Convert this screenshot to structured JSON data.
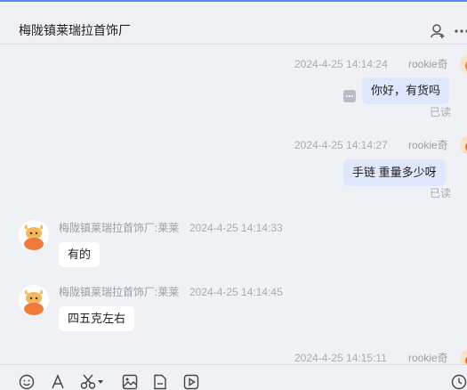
{
  "header": {
    "title": "梅陇镇莱瑞拉首饰厂",
    "icons": [
      "add-user-icon",
      "more-horizontal-icon"
    ]
  },
  "messages": [
    {
      "direction": "out",
      "time": "2024-4-25 14:14:24",
      "sender": "rookie奇",
      "text": "你好，有货吗",
      "status": "已读"
    },
    {
      "direction": "out",
      "time": "2024-4-25 14:14:27",
      "sender": "rookie奇",
      "text": "手链  重量多少呀",
      "status": "已读"
    },
    {
      "direction": "in",
      "time": "2024-4-25 14:14:33",
      "sender": "梅陇镇莱瑞拉首饰厂:莱莱",
      "text": "有的"
    },
    {
      "direction": "in",
      "time": "2024-4-25 14:14:45",
      "sender": "梅陇镇莱瑞拉首饰厂:莱莱",
      "text": "四五克左右"
    },
    {
      "direction": "out",
      "time": "2024-4-25 14:15:11",
      "sender": "rookie奇",
      "text": ""
    }
  ],
  "toolbar": {
    "icons": [
      "emoji-icon",
      "font-icon",
      "scissors-icon",
      "image-icon",
      "file-icon",
      "video-icon",
      "history-icon"
    ]
  },
  "colors": {
    "accent": "#4b8ef0",
    "outgoing_bubble": "#dfe7fd",
    "incoming_bubble": "#ffffff",
    "background": "#f0f1f5",
    "muted_text": "#a8abb2",
    "avatar_orange": "#f07a3c"
  }
}
